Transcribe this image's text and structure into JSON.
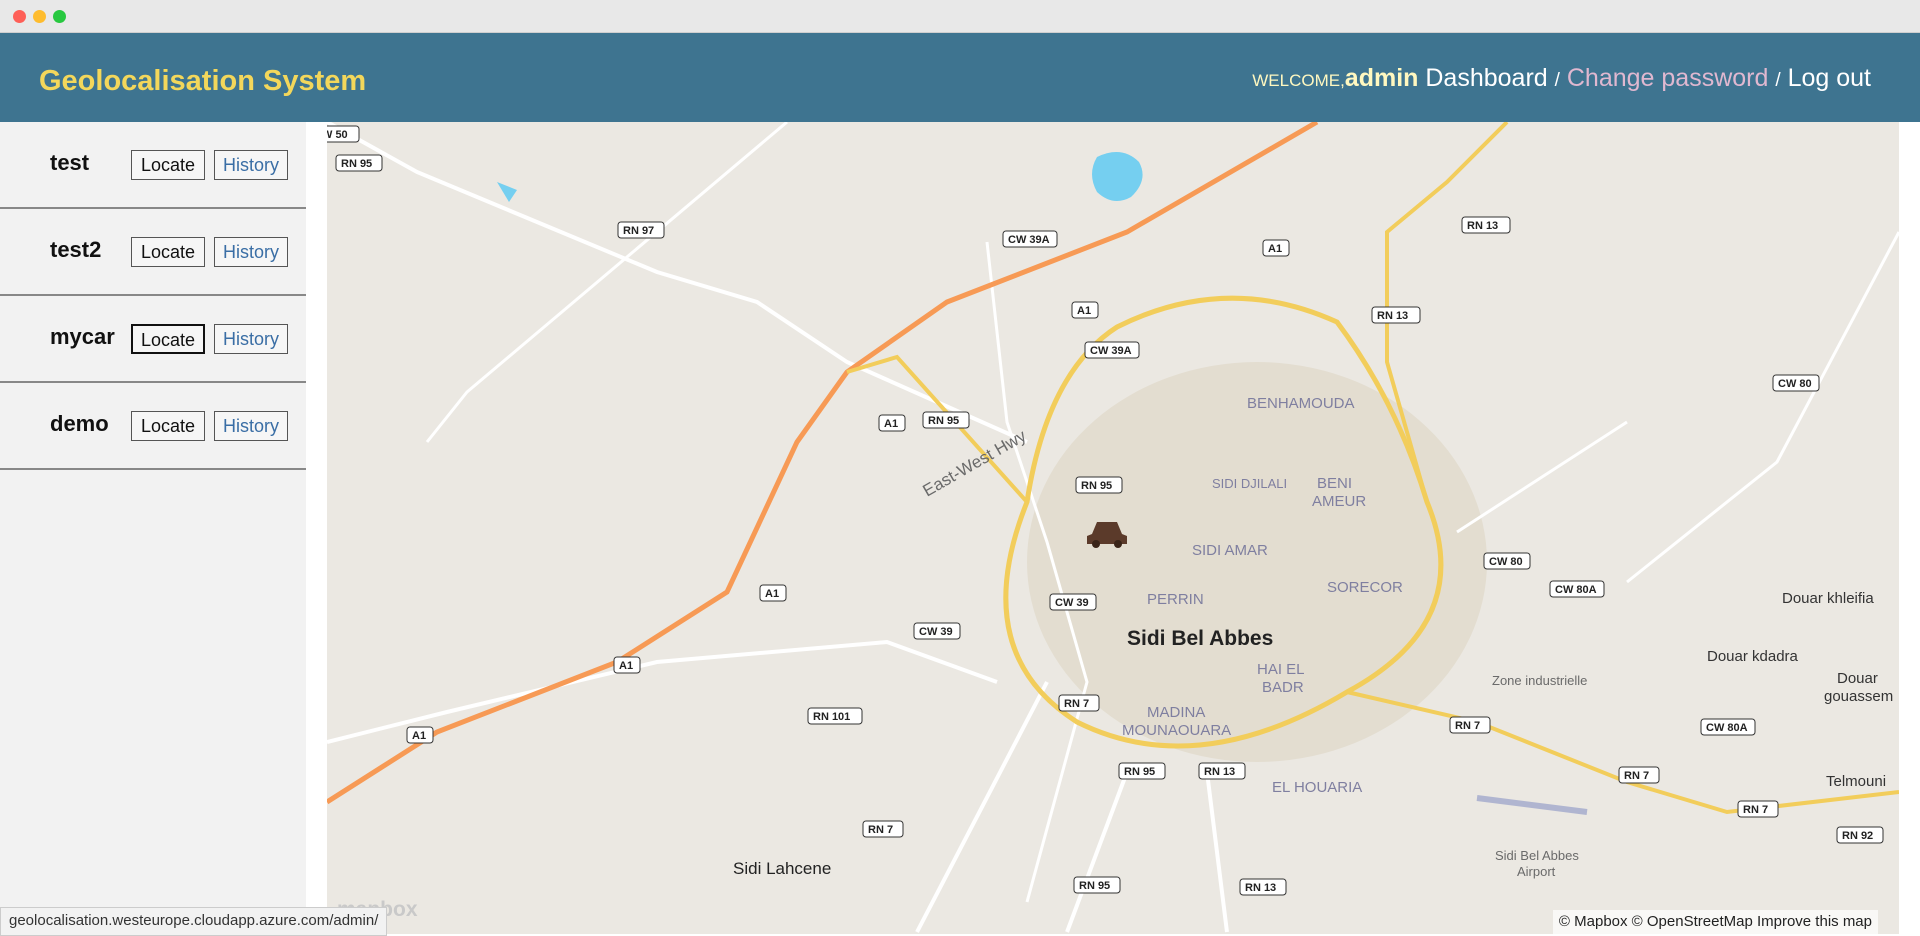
{
  "window": {
    "controls": [
      "close",
      "minimize",
      "maximize"
    ]
  },
  "header": {
    "brand": "Geolocalisation System",
    "welcome": "WELCOME,",
    "user": "admin",
    "nav": {
      "dashboard": "Dashboard",
      "change_password": "Change password",
      "logout": "Log out",
      "sep": "/"
    }
  },
  "devices": [
    {
      "name": "test",
      "locate": "Locate",
      "history": "History"
    },
    {
      "name": "test2",
      "locate": "Locate",
      "history": "History"
    },
    {
      "name": "mycar",
      "locate": "Locate",
      "history": "History"
    },
    {
      "name": "demo",
      "locate": "Locate",
      "history": "History"
    }
  ],
  "map": {
    "city": "Sidi Bel Abbes",
    "districts": [
      "BENHAMOUDA",
      "SIDI DJILALI",
      "BENI",
      "AMEUR",
      "SIDI AMAR",
      "PERRIN",
      "SORECOR",
      "HAI EL",
      "BADR",
      "MADINA",
      "MOUNAOUARA",
      "EL HOUARIA"
    ],
    "places": [
      "Sidi Lahcene",
      "Douar khleifia",
      "Douar kdadra",
      "Douar",
      "gouassem",
      "Telmouni",
      "Zone industrielle",
      "Sidi Bel Abbes",
      "Airport"
    ],
    "roads": [
      "RN 95",
      "RN 97",
      "CW 39A",
      "A1",
      "RN 13",
      "CW 80",
      "CW 80A",
      "RN 7",
      "RN 101",
      "CW 39",
      "RN 92",
      "W 50"
    ],
    "highway": "East-West Hwy",
    "marker": "car-marker",
    "attribution": "© Mapbox © OpenStreetMap Improve this map",
    "logo": "mapbox"
  },
  "status_url": "geolocalisation.westeurope.cloudapp.azure.com/admin/"
}
